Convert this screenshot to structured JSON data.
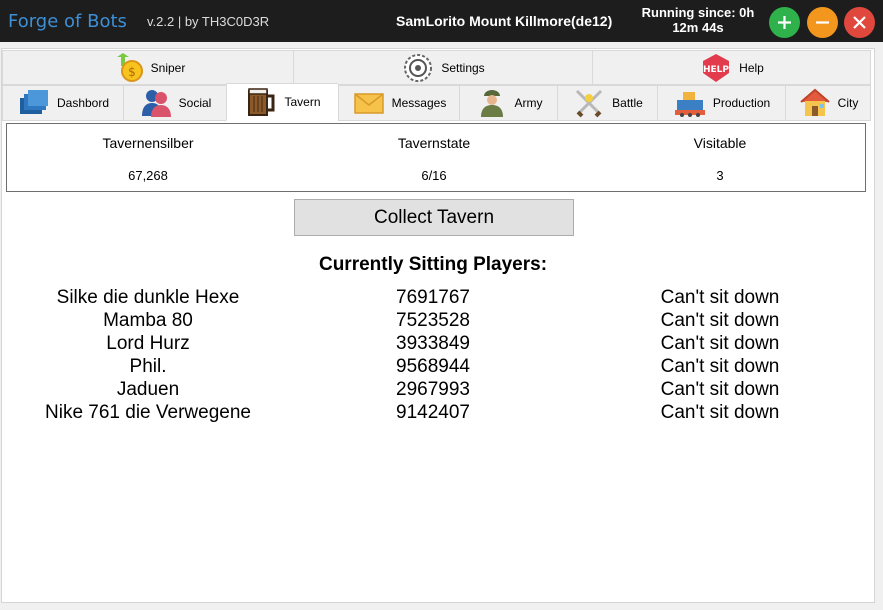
{
  "window": {
    "app_title": "Forge of Bots",
    "version": "v.2.2 | by TH3C0D3R",
    "account": "SamLorito Mount Killmore(de12)",
    "running_line1": "Running since: 0h",
    "running_line2": "12m 44s",
    "buttons": {
      "add_color": "#2fb24c",
      "minimize_color": "#f3961e",
      "close_color": "#e0483e"
    }
  },
  "tabs_top": [
    {
      "label": "Sniper",
      "icon": "sniper-coin-icon"
    },
    {
      "label": "Settings",
      "icon": "settings-gear-icon"
    },
    {
      "label": "Help",
      "icon": "help-badge-icon"
    }
  ],
  "tabs_bottom": [
    {
      "label": "Dashbord",
      "icon": "dashboard-icon"
    },
    {
      "label": "Social",
      "icon": "social-icon"
    },
    {
      "label": "Tavern",
      "icon": "tavern-mug-icon",
      "active": true
    },
    {
      "label": "Messages",
      "icon": "envelope-icon"
    },
    {
      "label": "Army",
      "icon": "soldier-icon"
    },
    {
      "label": "Battle",
      "icon": "crossed-swords-icon"
    },
    {
      "label": "Production",
      "icon": "factory-icon"
    },
    {
      "label": "City",
      "icon": "house-icon"
    }
  ],
  "stats": {
    "silver_label": "Tavernensilber",
    "silver_value": "67,268",
    "state_label": "Tavernstate",
    "state_value": "6/16",
    "visitable_label": "Visitable",
    "visitable_value": "3"
  },
  "collect_label": "Collect Tavern",
  "players_title": "Currently Sitting Players:",
  "players": [
    {
      "name": "Silke die dunkle Hexe",
      "id": "7691767",
      "status": "Can't sit down"
    },
    {
      "name": "Mamba 80",
      "id": "7523528",
      "status": "Can't sit down"
    },
    {
      "name": "Lord Hurz",
      "id": "3933849",
      "status": "Can't sit down"
    },
    {
      "name": "Phil.",
      "id": "9568944",
      "status": "Can't sit down"
    },
    {
      "name": "Jaduen",
      "id": "2967993",
      "status": "Can't sit down"
    },
    {
      "name": "Nike 761 die Verwegene",
      "id": "9142407",
      "status": "Can't sit down"
    }
  ]
}
